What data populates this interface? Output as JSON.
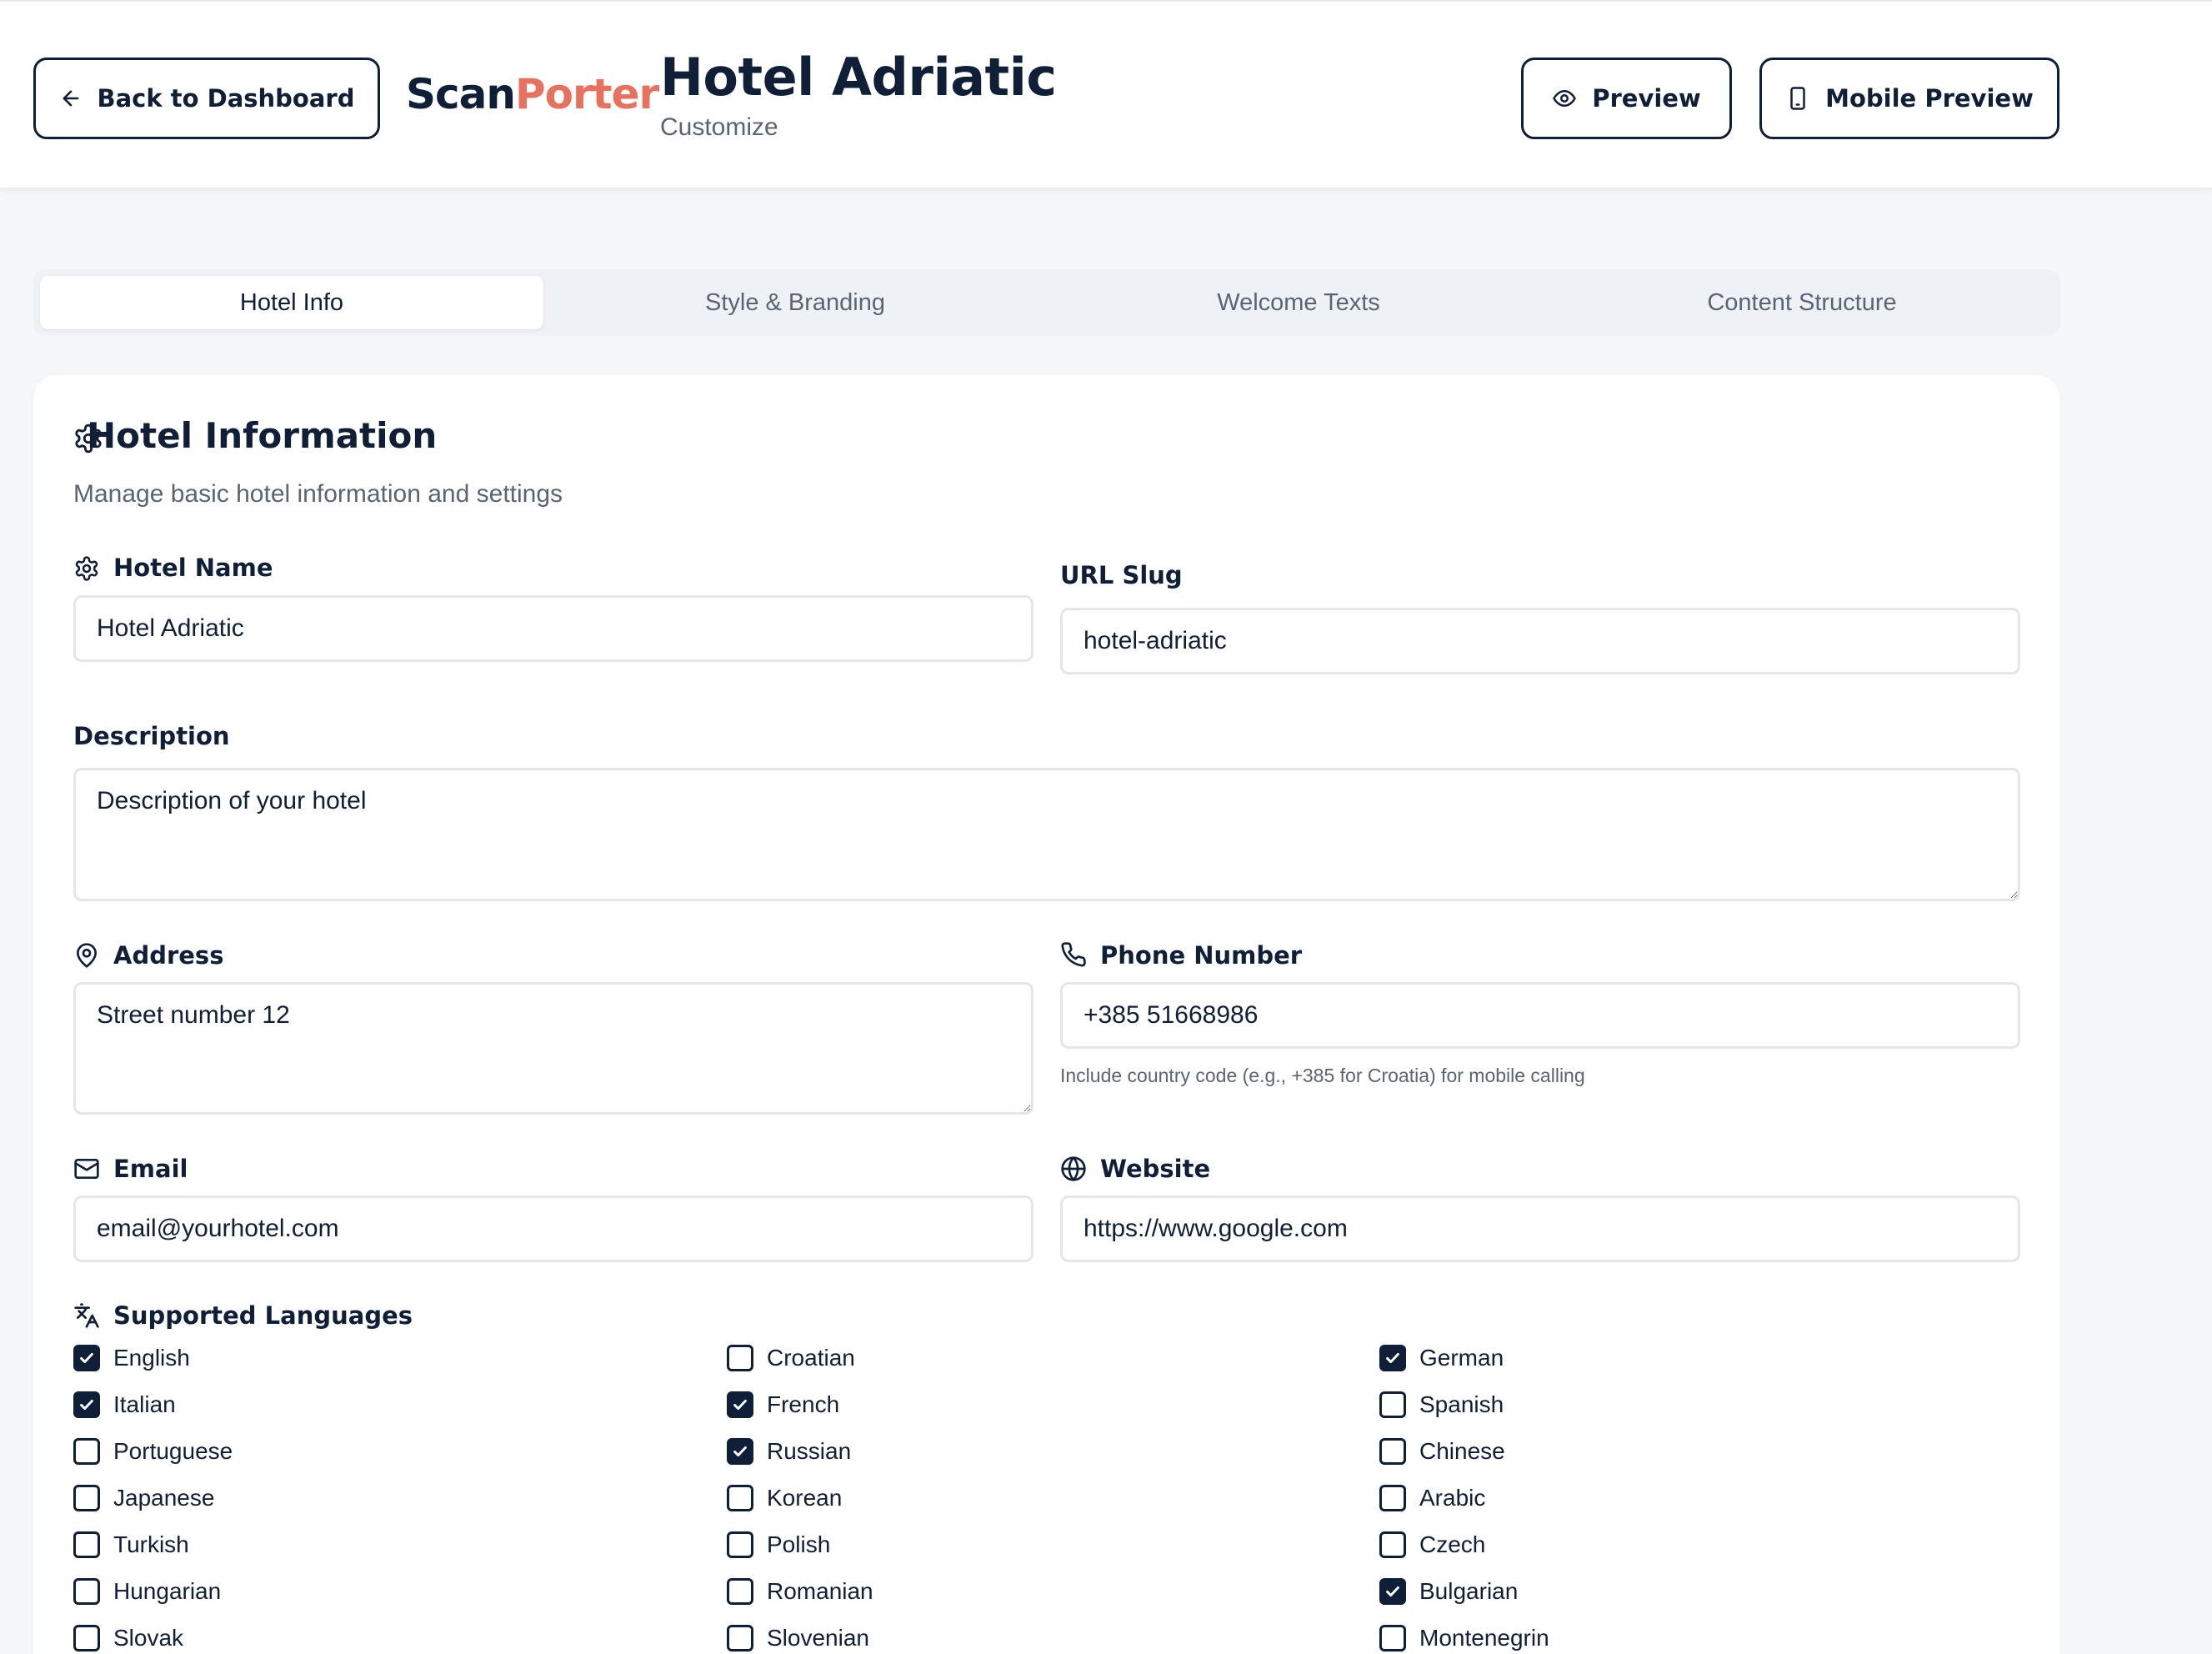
{
  "header": {
    "back_label": "Back to Dashboard",
    "logo_part1": "Scan",
    "logo_part2": "Porter",
    "title": "Hotel Adriatic",
    "subtitle": "Customize",
    "preview_label": "Preview",
    "mobile_preview_label": "Mobile Preview"
  },
  "tabs": [
    {
      "label": "Hotel Info",
      "active": true
    },
    {
      "label": "Style & Branding",
      "active": false
    },
    {
      "label": "Welcome Texts",
      "active": false
    },
    {
      "label": "Content Structure",
      "active": false
    }
  ],
  "card": {
    "title": "Hotel Information",
    "subtitle": "Manage basic hotel information and settings"
  },
  "form": {
    "hotel_name": {
      "label": "Hotel Name",
      "value": "Hotel Adriatic"
    },
    "url_slug": {
      "label": "URL Slug",
      "value": "hotel-adriatic"
    },
    "description": {
      "label": "Description",
      "value": "Description of your hotel"
    },
    "address": {
      "label": "Address",
      "value": "Street number 12"
    },
    "phone": {
      "label": "Phone Number",
      "value": "+385 51668986",
      "hint": "Include country code (e.g., +385 for Croatia) for mobile calling"
    },
    "email": {
      "label": "Email",
      "value": "email@yourhotel.com"
    },
    "website": {
      "label": "Website",
      "value": "https://www.google.com"
    }
  },
  "languages": {
    "label": "Supported Languages",
    "items": [
      {
        "name": "English",
        "checked": true
      },
      {
        "name": "Croatian",
        "checked": false
      },
      {
        "name": "German",
        "checked": true
      },
      {
        "name": "Italian",
        "checked": true
      },
      {
        "name": "French",
        "checked": true
      },
      {
        "name": "Spanish",
        "checked": false
      },
      {
        "name": "Portuguese",
        "checked": false
      },
      {
        "name": "Russian",
        "checked": true
      },
      {
        "name": "Chinese",
        "checked": false
      },
      {
        "name": "Japanese",
        "checked": false
      },
      {
        "name": "Korean",
        "checked": false
      },
      {
        "name": "Arabic",
        "checked": false
      },
      {
        "name": "Turkish",
        "checked": false
      },
      {
        "name": "Polish",
        "checked": false
      },
      {
        "name": "Czech",
        "checked": false
      },
      {
        "name": "Hungarian",
        "checked": false
      },
      {
        "name": "Romanian",
        "checked": false
      },
      {
        "name": "Bulgarian",
        "checked": true
      },
      {
        "name": "Slovak",
        "checked": false
      },
      {
        "name": "Slovenian",
        "checked": false
      },
      {
        "name": "Montenegrin",
        "checked": false
      }
    ]
  },
  "colors": {
    "navy": "#0f1f38",
    "accent": "#e8705d"
  }
}
